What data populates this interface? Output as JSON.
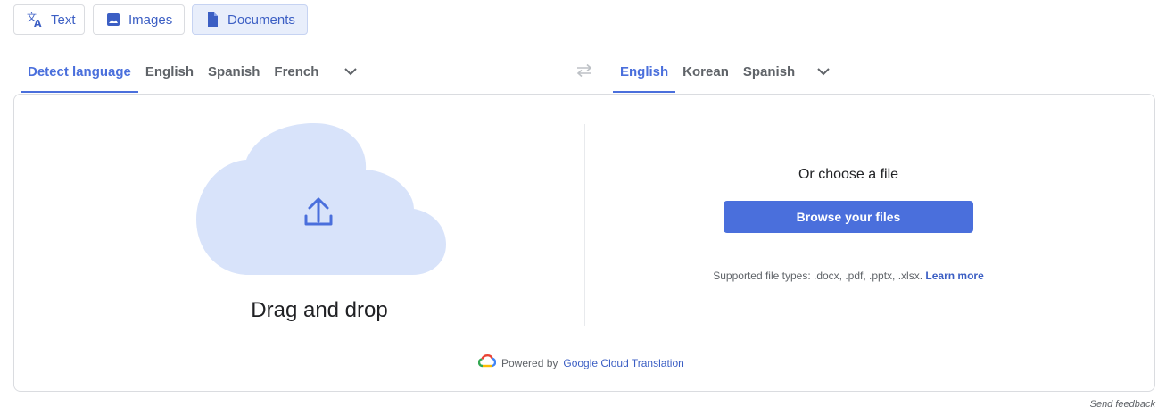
{
  "modes": {
    "text_label": "Text",
    "images_label": "Images",
    "documents_label": "Documents"
  },
  "source_languages": {
    "items": [
      "Detect language",
      "English",
      "Spanish",
      "French"
    ]
  },
  "target_languages": {
    "items": [
      "English",
      "Korean",
      "Spanish"
    ]
  },
  "upload": {
    "drag_text": "Drag and drop",
    "choose_text": "Or choose a file",
    "browse_label": "Browse your files",
    "supported_text": "Supported file types: .docx, .pdf, .pptx, .xlsx.",
    "learn_more": "Learn more"
  },
  "footer": {
    "powered_by": "Powered by",
    "powered_link": "Google Cloud Translation",
    "send_feedback": "Send feedback"
  },
  "colors": {
    "accent": "#4a6fdc",
    "cloud_fill": "#d8e3fa",
    "active_mode_bg": "#e8eefb"
  }
}
